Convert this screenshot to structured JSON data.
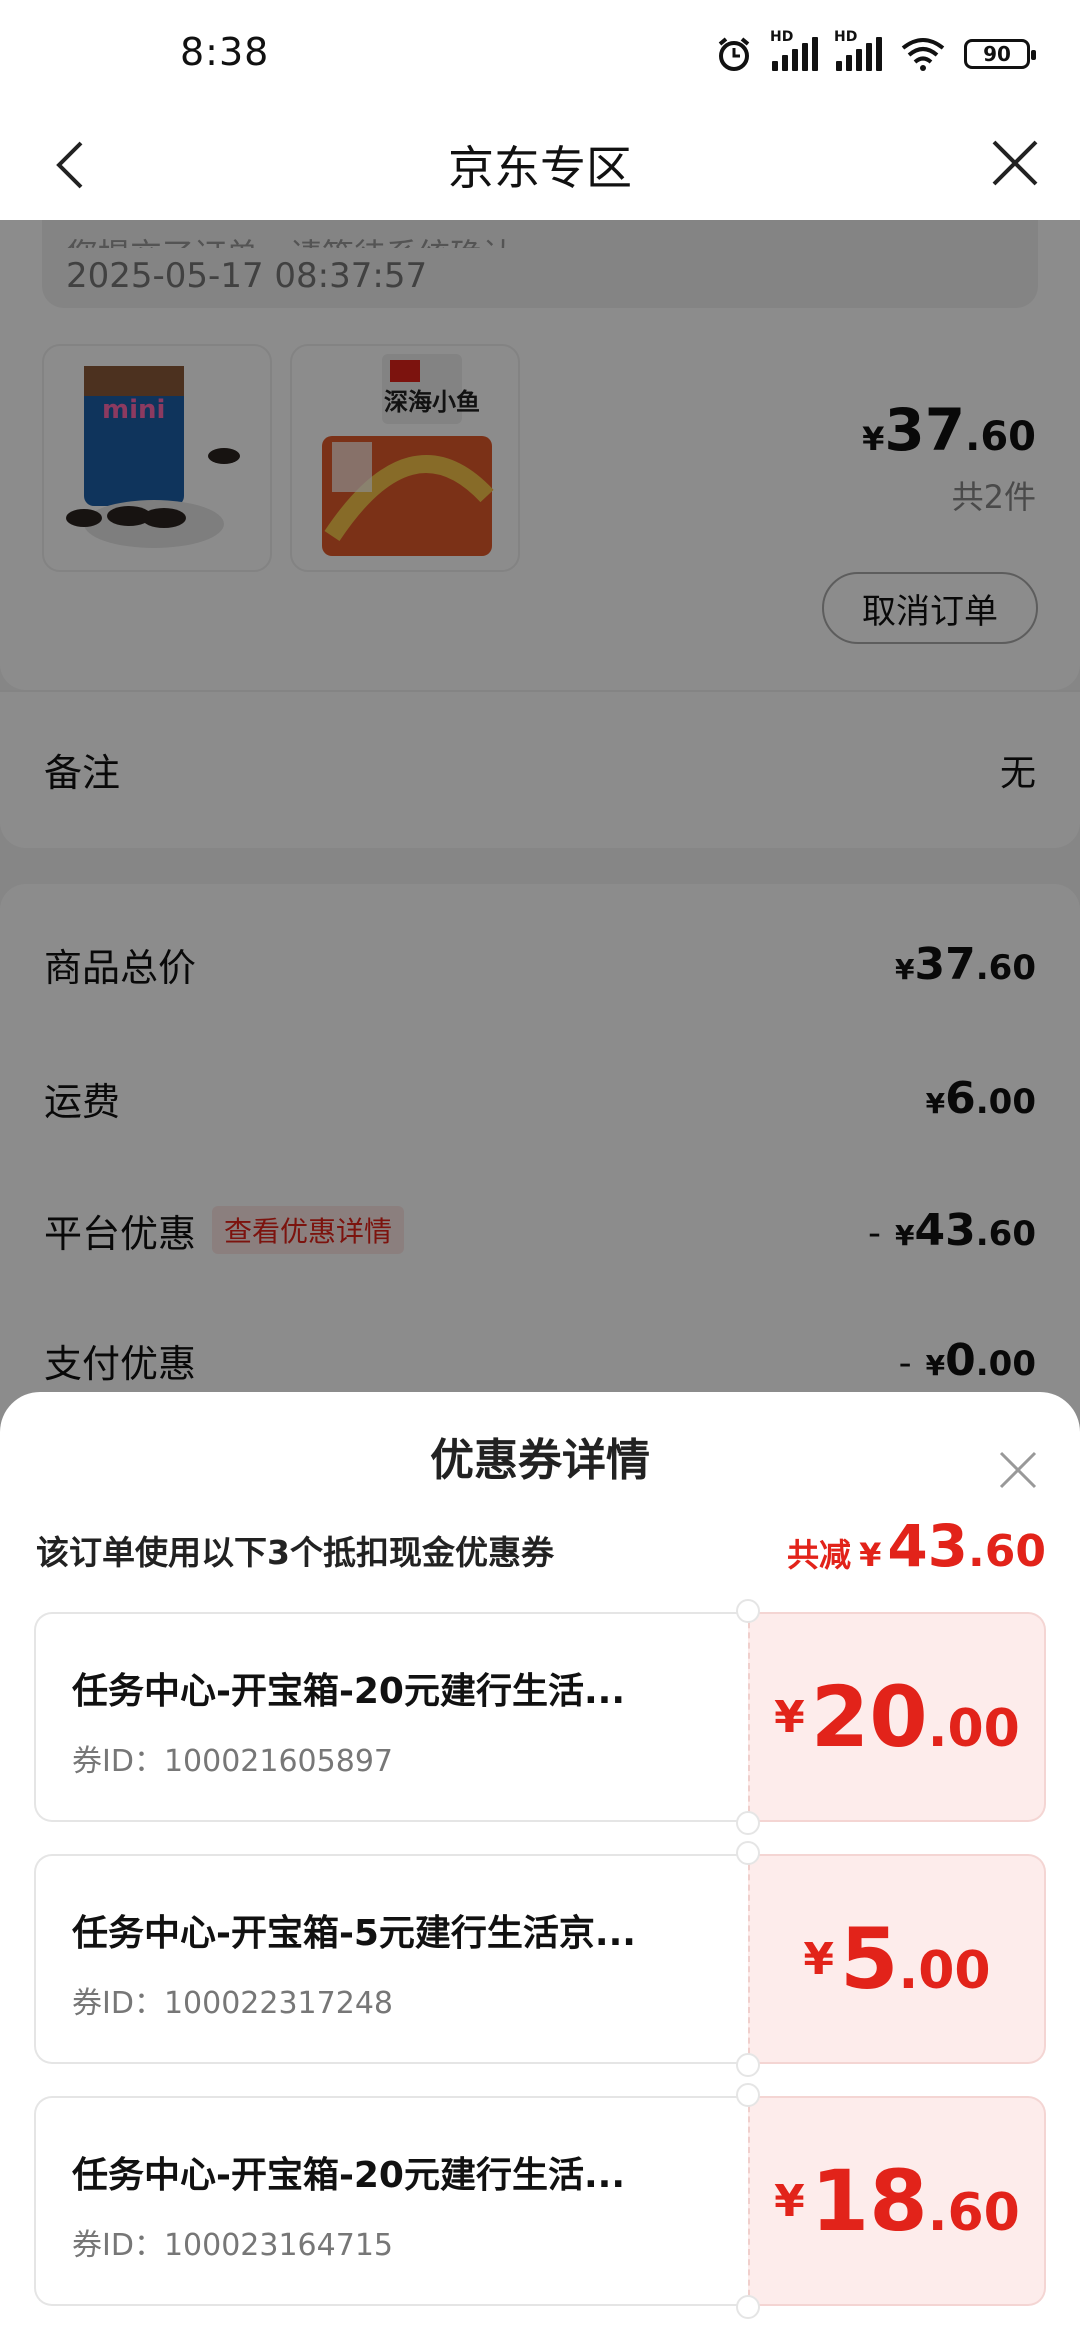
{
  "status_bar": {
    "time": "8:38",
    "battery": "90",
    "hd1": "HD",
    "hd2": "HD"
  },
  "header": {
    "title": "京东专区"
  },
  "order": {
    "notice_line1": "您提交了订单，请等待系统确认",
    "notice_time": "2025-05-17 08:37:57",
    "products": [
      {
        "name": "mini奥利奥"
      },
      {
        "name": "深海小鱼"
      }
    ],
    "price": {
      "currency": "¥",
      "int": "37",
      "dec": ".60"
    },
    "count": "共2件",
    "cancel_label": "取消订单"
  },
  "remark": {
    "label": "备注",
    "value": "无"
  },
  "fees": {
    "goods_total": {
      "label": "商品总价",
      "currency": "¥",
      "int": "37",
      "dec": ".60"
    },
    "shipping": {
      "label": "运费",
      "currency": "¥",
      "int": "6",
      "dec": ".00"
    },
    "platform_discount": {
      "label": "平台优惠",
      "link": "查看优惠详情",
      "minus": "-",
      "currency": "¥",
      "int": "43",
      "dec": ".60"
    },
    "payment_discount": {
      "label": "支付优惠",
      "minus": "-",
      "currency": "¥",
      "int": "0",
      "dec": ".00"
    }
  },
  "sheet": {
    "title": "优惠券详情",
    "subtitle": "该订单使用以下3个抵扣现金优惠券",
    "total_label": "共减",
    "total_currency": "¥",
    "total_int": "43",
    "total_dec": ".60",
    "coupons": [
      {
        "name": "任务中心-开宝箱-20元建行生活...",
        "id": "券ID：100021605897",
        "currency": "¥",
        "int": "20",
        "dec": ".00"
      },
      {
        "name": "任务中心-开宝箱-5元建行生活京...",
        "id": "券ID：100022317248",
        "currency": "¥",
        "int": "5",
        "dec": ".00"
      },
      {
        "name": "任务中心-开宝箱-20元建行生活...",
        "id": "券ID：100023164715",
        "currency": "¥",
        "int": "18",
        "dec": ".60"
      }
    ]
  },
  "colors": {
    "accent": "#e2231a",
    "coupon_bg": "#fdeceb"
  }
}
